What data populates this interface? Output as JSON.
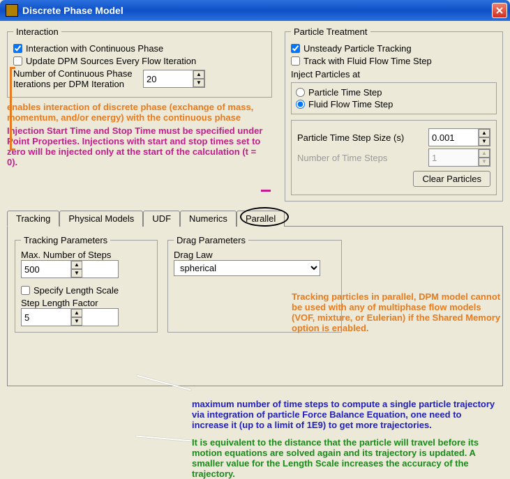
{
  "window": {
    "title": "Discrete Phase Model"
  },
  "interaction": {
    "legend": "Interaction",
    "cb1": "Interaction with Continuous Phase",
    "cb2": "Update DPM Sources Every Flow Iteration",
    "iter_label": "Number of Continuous Phase Iterations per DPM Iteration",
    "iter_value": "20"
  },
  "treatment": {
    "legend": "Particle Treatment",
    "cb1": "Unsteady Particle Tracking",
    "cb2": "Track with Fluid Flow Time Step",
    "inject_label": "Inject Particles at",
    "r1": "Particle Time Step",
    "r2": "Fluid Flow Time Step",
    "tss_label": "Particle Time Step Size (s)",
    "tss_value": "0.001",
    "nsteps_label": "Number of Time Steps",
    "nsteps_value": "1",
    "clear_btn": "Clear Particles"
  },
  "annotations": {
    "a1": "enables interaction of discrete phase (exchange of mass, momentum, and/or energy) with the continuous phase",
    "a2": "Injection Start Time and Stop Time must be specified under Point Properties. Injections with start and stop times set to zero will be injected only at the start of the calculation (t = 0).",
    "a3": "Tracking particles in parallel, DPM model cannot be used with any of  multiphase flow models (VOF, mixture, or Eulerian) if the Shared Memory option is enabled.",
    "a4": "maximum number of time steps to compute a single particle trajectory via integration of particle Force Balance Equation, one need to increase it (up to a limit of 1E9) to get more trajectories.",
    "a5": "It is equivalent to the distance that the particle will travel before its motion equations are solved again and its trajectory is updated.  A smaller value for the Length Scale increases the accuracy of the trajectory."
  },
  "tabs": {
    "t1": "Tracking",
    "t2": "Physical Models",
    "t3": "UDF",
    "t4": "Numerics",
    "t5": "Parallel"
  },
  "tracking": {
    "legend": "Tracking Parameters",
    "maxsteps_label": "Max. Number of Steps",
    "maxsteps_value": "500",
    "specify_label": "Specify Length Scale",
    "slf_label": "Step Length Factor",
    "slf_value": "5"
  },
  "drag": {
    "legend": "Drag Parameters",
    "law_label": "Drag Law",
    "law_value": "spherical"
  }
}
